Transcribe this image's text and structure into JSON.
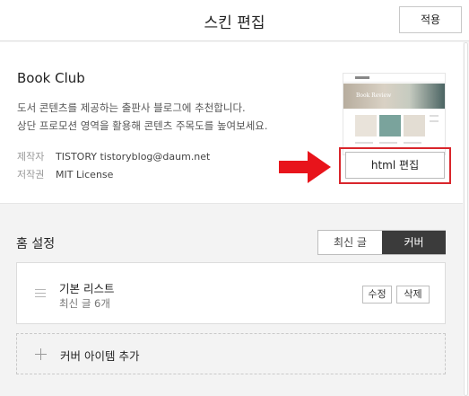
{
  "header": {
    "title": "스킨 편집",
    "apply_label": "적용"
  },
  "skin": {
    "name": "Book Club",
    "desc_line1": "도서 콘텐츠를 제공하는 출판사 블로그에 추천합니다.",
    "desc_line2": "상단 프로모션 영역을 활용해 콘텐츠 주목도를 높여보세요.",
    "maker_label": "제작자",
    "maker_value": "TISTORY tistoryblog@daum.net",
    "license_label": "저작권",
    "license_value": "MIT License",
    "thumbnail_text": "Book Review",
    "html_edit_label": "html 편집"
  },
  "home": {
    "title": "홈 설정",
    "tabs": [
      {
        "label": "최신 글",
        "selected": false
      },
      {
        "label": "커버",
        "selected": true
      }
    ],
    "items": [
      {
        "title": "기본 리스트",
        "subtitle": "최신 글 6개",
        "edit_label": "수정",
        "delete_label": "삭제"
      }
    ],
    "add_label": "커버 아이템 추가"
  },
  "colors": {
    "highlight": "#d9262c",
    "arrow": "#e8141b",
    "selected_tab": "#3b3b3b"
  }
}
